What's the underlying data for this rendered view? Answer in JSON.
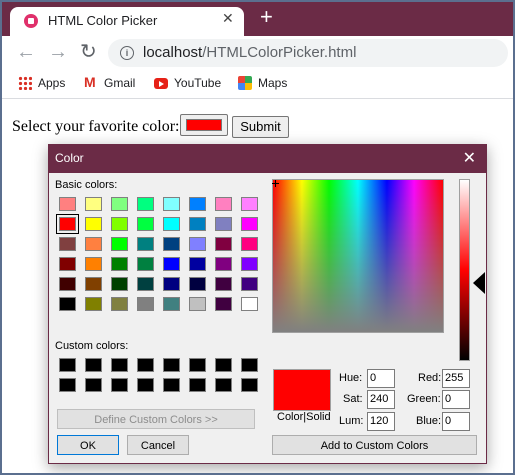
{
  "browser": {
    "tab_title": "HTML Color Picker",
    "tab_close": "✕",
    "new_tab": "+",
    "nav": {
      "back": "←",
      "forward": "→",
      "reload": "↻"
    },
    "url_host": "localhost",
    "url_path": "/HTMLColorPicker.html",
    "bookmarks": [
      "Apps",
      "Gmail",
      "YouTube",
      "Maps"
    ]
  },
  "page": {
    "label": "Select your favorite color:",
    "color_value": "#ff0000",
    "submit_label": "Submit"
  },
  "dialog": {
    "title": "Color",
    "close": "✕",
    "basic_colors_label": "Basic colors:",
    "basic_colors": [
      "#ff8080",
      "#ffff80",
      "#80ff80",
      "#00ff80",
      "#80ffff",
      "#0080ff",
      "#ff80c0",
      "#ff80ff",
      "#ff0000",
      "#ffff00",
      "#80ff00",
      "#00ff40",
      "#00ffff",
      "#0080c0",
      "#8080c0",
      "#ff00ff",
      "#804040",
      "#ff8040",
      "#00ff00",
      "#008080",
      "#004080",
      "#8080ff",
      "#800040",
      "#ff0080",
      "#800000",
      "#ff8000",
      "#008000",
      "#008040",
      "#0000ff",
      "#0000a0",
      "#800080",
      "#8000ff",
      "#400000",
      "#804000",
      "#004000",
      "#004040",
      "#000080",
      "#000040",
      "#400040",
      "#400080",
      "#000000",
      "#808000",
      "#808040",
      "#808080",
      "#408080",
      "#c0c0c0",
      "#400040",
      "#ffffff"
    ],
    "selected_basic_index": 8,
    "custom_colors_label": "Custom colors:",
    "custom_colors": [
      "#000000",
      "#000000",
      "#000000",
      "#000000",
      "#000000",
      "#000000",
      "#000000",
      "#000000",
      "#000000",
      "#000000",
      "#000000",
      "#000000",
      "#000000",
      "#000000",
      "#000000",
      "#000000"
    ],
    "define_custom_label": "Define Custom Colors >>",
    "ok_label": "OK",
    "cancel_label": "Cancel",
    "color_solid_label": "Color|Solid",
    "hue_label": "Hue:",
    "hue_value": "0",
    "sat_label": "Sat:",
    "sat_value": "240",
    "lum_label": "Lum:",
    "lum_value": "120",
    "red_label": "Red:",
    "red_value": "255",
    "green_label": "Green:",
    "green_value": "0",
    "blue_label": "Blue:",
    "blue_value": "0",
    "add_custom_label": "Add to Custom Colors"
  }
}
